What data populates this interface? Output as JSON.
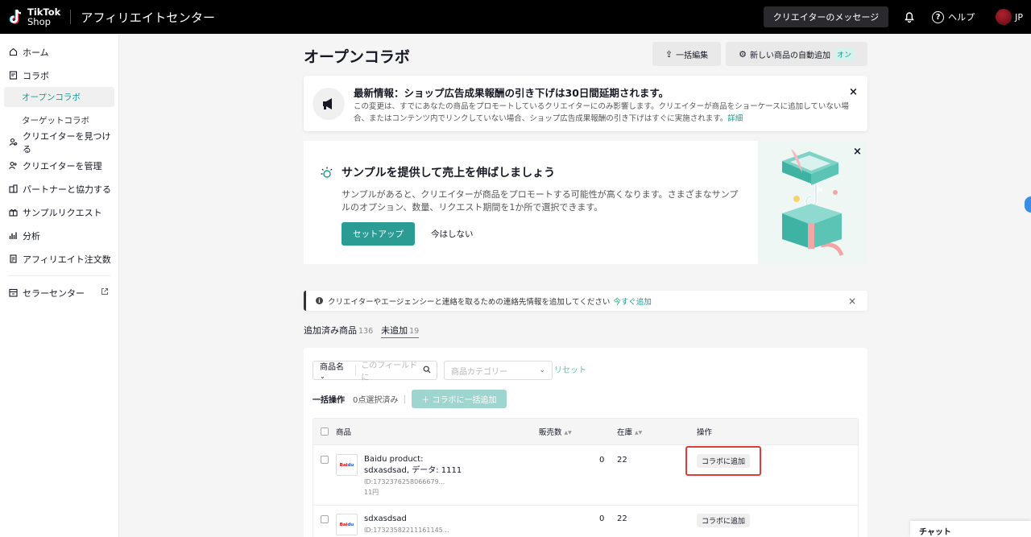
{
  "header": {
    "brand_line1": "TikTok",
    "brand_line2": "Shop",
    "app_title": "アフィリエイトセンター",
    "messages_label": "クリエイターのメッセージ",
    "help_label": "ヘルプ",
    "region": "JP"
  },
  "sidebar": {
    "items": [
      {
        "label": "ホーム",
        "icon": "home-icon"
      },
      {
        "label": "コラボ",
        "icon": "collab-icon"
      },
      {
        "label": "クリエイターを見つける",
        "icon": "find-creator-icon"
      },
      {
        "label": "クリエイターを管理",
        "icon": "manage-creator-icon"
      },
      {
        "label": "パートナーと協力する",
        "icon": "partner-icon"
      },
      {
        "label": "サンプルリクエスト",
        "icon": "gift-icon"
      },
      {
        "label": "分析",
        "icon": "chart-icon"
      },
      {
        "label": "アフィリエイト注文数",
        "icon": "orders-icon"
      },
      {
        "label": "セラーセンター",
        "icon": "store-icon"
      }
    ],
    "sub_items": [
      {
        "label": "オープンコラボ",
        "active": true
      },
      {
        "label": "ターゲットコラボ",
        "active": false
      }
    ]
  },
  "page": {
    "title": "オープンコラボ",
    "bulk_edit_label": "一括編集",
    "auto_add_label": "新しい商品の自動追加",
    "auto_add_status": "オン"
  },
  "notice": {
    "title": "最新情報：ショップ広告成果報酬の引き下げは30日間延期されます。",
    "body": "この変更は、すでにあなたの商品をプロモートしているクリエイターにのみ影響します。クリエイターが商品をショーケースに追加していない場合、またはコンテンツ内でリンクしていない場合、ショップ広告成果報酬の引き下げはすぐに実施されます。",
    "link": "詳細"
  },
  "sample_card": {
    "title": "サンプルを提供して売上を伸ばしましょう",
    "body": "サンプルがあると、クリエイターが商品をプロモートする可能性が高くなります。さまざまなサンプルのオプション、数量、リクエスト期間を1か所で選択できます。",
    "setup_label": "セットアップ",
    "later_label": "今はしない"
  },
  "contact_bar": {
    "text": "クリエイターやエージェンシーと連絡を取るための連絡先情報を追加してください",
    "link": "今すぐ追加"
  },
  "tabs": [
    {
      "label": "追加済み商品",
      "count": "136"
    },
    {
      "label": "未追加",
      "count": "19"
    }
  ],
  "filters": {
    "field_label": "商品名",
    "search_placeholder": "このフィールドに",
    "category_placeholder": "商品カテゴリー",
    "reset_label": "リセット"
  },
  "bulk": {
    "label": "一括操作",
    "selected": "0点選択済み",
    "add_label": "＋ コラボに一括追加"
  },
  "table": {
    "headers": {
      "product": "商品",
      "sales": "販売数",
      "stock": "在庫",
      "action": "操作"
    },
    "rows": [
      {
        "name_line1": "Baidu product:",
        "name_line2": "sdxasdsad, データ: 1111",
        "id": "ID:1732376258066679...",
        "price": "11円",
        "sales": "0",
        "stock": "22",
        "action": "コラボに追加"
      },
      {
        "name_line1": "sdxasdsad",
        "name_line2": "",
        "id": "ID:17323582211161145...",
        "price": "",
        "sales": "0",
        "stock": "22",
        "action": "コラボに追加"
      }
    ]
  },
  "chat": {
    "label": "チャット"
  },
  "colors": {
    "accent": "#1a9a8f",
    "highlight": "#e03b3b"
  }
}
